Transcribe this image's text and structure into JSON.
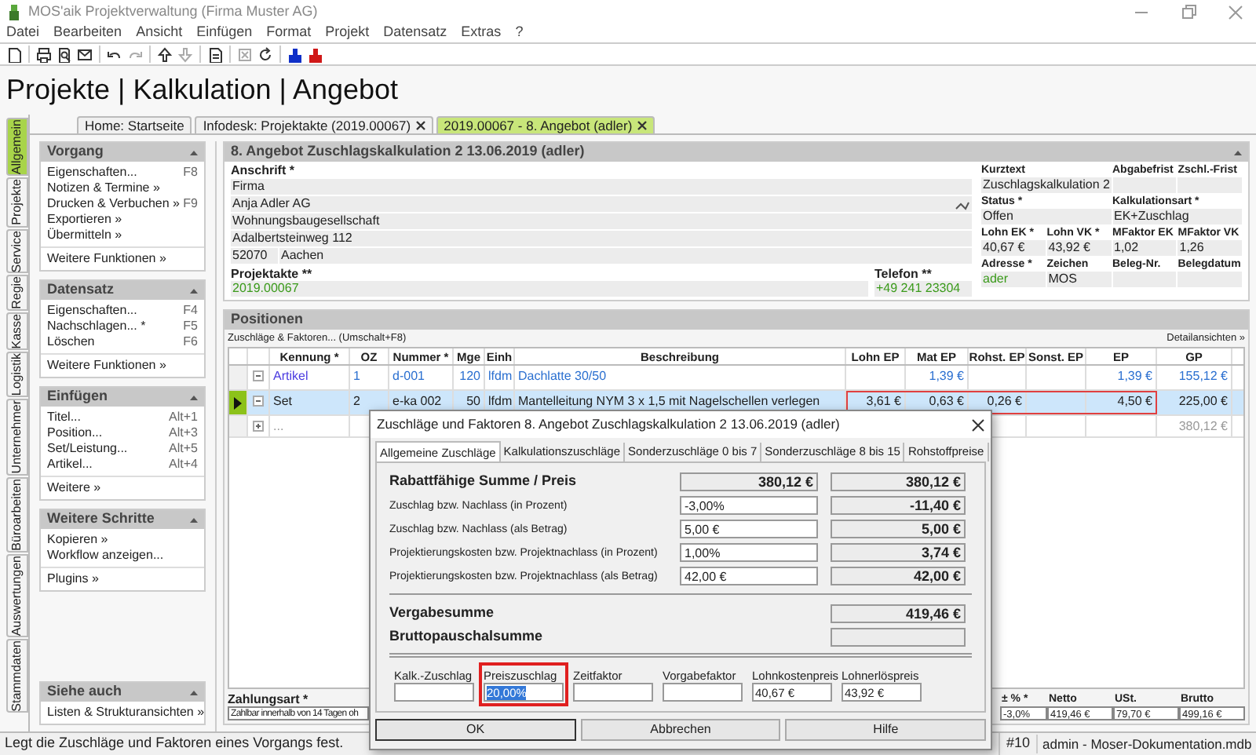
{
  "window": {
    "title": "MOS'aik Projektverwaltung (Firma Muster AG)"
  },
  "menu": [
    "Datei",
    "Bearbeiten",
    "Ansicht",
    "Einfügen",
    "Format",
    "Projekt",
    "Datensatz",
    "Extras",
    "?"
  ],
  "heading": "Projekte | Kalkulation | Angebot",
  "doc_tabs": [
    {
      "label": "Home: Startseite",
      "selected": false,
      "closable": false
    },
    {
      "label": "Infodesk: Projektakte (2019.00067)",
      "selected": false,
      "closable": true
    },
    {
      "label": "2019.00067 - 8. Angebot (adler)",
      "selected": true,
      "closable": true
    }
  ],
  "side_tabs": [
    {
      "label": "Allgemein",
      "selected": true
    },
    {
      "label": "Projekte",
      "selected": false
    },
    {
      "label": "Service",
      "selected": false
    },
    {
      "label": "Regie",
      "selected": false
    },
    {
      "label": "Kasse",
      "selected": false
    },
    {
      "label": "Logistik",
      "selected": false
    },
    {
      "label": "Unternehmer",
      "selected": false
    },
    {
      "label": "Büroarbeiten",
      "selected": false
    },
    {
      "label": "Auswertungen",
      "selected": false
    },
    {
      "label": "Stammdaten",
      "selected": false
    }
  ],
  "panels": [
    {
      "title": "Vorgang",
      "items": [
        {
          "label": "Eigenschaften...",
          "shortcut": "F8"
        },
        {
          "label": "Notizen & Termine »"
        },
        {
          "label": "Drucken & Verbuchen »",
          "shortcut": "F9"
        },
        {
          "label": "Exportieren »"
        },
        {
          "label": "Übermitteln »"
        }
      ],
      "more": [
        "Weitere Funktionen »"
      ]
    },
    {
      "title": "Datensatz",
      "items": [
        {
          "label": "Eigenschaften...",
          "shortcut": "F4"
        },
        {
          "label": "Nachschlagen... *",
          "shortcut": "F5"
        },
        {
          "label": "Löschen",
          "shortcut": "F6"
        }
      ],
      "more": [
        "Weitere Funktionen »"
      ]
    },
    {
      "title": "Einfügen",
      "items": [
        {
          "label": "Titel...",
          "shortcut": "Alt+1"
        },
        {
          "label": "Position...",
          "shortcut": "Alt+3"
        },
        {
          "label": "Set/Leistung...",
          "shortcut": "Alt+5"
        },
        {
          "label": "Artikel...",
          "shortcut": "Alt+4"
        }
      ],
      "more": [
        "Weitere »"
      ]
    },
    {
      "title": "Weitere Schritte",
      "items": [
        {
          "label": "Kopieren »"
        },
        {
          "label": "Workflow anzeigen..."
        }
      ],
      "more": [
        "Plugins »"
      ]
    },
    {
      "title": "Siehe auch",
      "items": [
        {
          "label": "Listen & Strukturansichten »"
        }
      ]
    }
  ],
  "document": {
    "title": "8. Angebot Zuschlagskalkulation 2 13.06.2019 (adler)",
    "address": {
      "label": "Anschrift *",
      "lines": [
        "Firma",
        "Anja Adler AG",
        "Wohnungsbaugesellschaft",
        "Adalbertsteinweg 112"
      ],
      "zip": "52070",
      "city": "Aachen"
    },
    "projektakte": {
      "label": "Projektakte **",
      "value": "2019.00067",
      "link": true
    },
    "telefon": {
      "label": "Telefon **",
      "value": "+49 241 23304",
      "link": true
    },
    "fields": [
      {
        "label": "Kurztext",
        "value": "Zuschlagskalkulation 2",
        "link": false
      },
      {
        "label": "Abgabefrist"
      },
      {
        "label": "Zschl.-Frist"
      },
      {
        "label": "Status *",
        "value": "Offen",
        "link": false
      },
      {
        "label": "Kalkulationsart *",
        "value": "EK+Zuschlag",
        "link": false
      },
      {
        "label": "Lohn EK *",
        "value": "40,67 €",
        "link": false
      },
      {
        "label": "Lohn VK *",
        "value": "43,92 €",
        "link": false
      },
      {
        "label": "MFaktor EK",
        "value": "1,02",
        "link": false
      },
      {
        "label": "MFaktor VK",
        "value": "1,26",
        "link": false
      },
      {
        "label": "Adresse *",
        "value": "ader",
        "link": true
      },
      {
        "label": "Zeichen",
        "value": "MOS",
        "link": false
      },
      {
        "label": "Beleg-Nr."
      },
      {
        "label": "Belegdatum"
      }
    ]
  },
  "positions": {
    "title": "Positionen",
    "action": "Zuschläge & Faktoren... (Umschalt+F8)",
    "detail_link": "Detailansichten »",
    "columns": [
      "Kennung *",
      "OZ",
      "Nummer *",
      "Mge",
      "Einh",
      "Beschreibung",
      "Lohn EP",
      "Mat EP",
      "Rohst. EP",
      "Sonst. EP",
      "EP",
      "GP"
    ],
    "rows": [
      {
        "kind": "artikel",
        "selected": false,
        "expanded": true,
        "outlined": false,
        "cells": [
          "Artikel",
          "1",
          "d-001",
          "120",
          "lfdm",
          "Dachlatte 30/50",
          null,
          "1,39 €",
          null,
          null,
          "1,39 €",
          "155,12 €"
        ]
      },
      {
        "kind": "set",
        "selected": true,
        "expanded": true,
        "outlined": true,
        "cells": [
          "Set",
          "2",
          "e-ka 002",
          "50",
          "lfdm",
          "Mantelleitung NYM 3 x 1,5 mit Nagelschellen verlegen",
          "3,61 €",
          "0,63 €",
          "0,26 €",
          null,
          "4,50 €",
          "225,00 €"
        ]
      },
      {
        "kind": "new",
        "selected": false,
        "expanded": false,
        "outlined": false,
        "cells": [
          "...",
          null,
          null,
          null,
          null,
          null,
          null,
          null,
          null,
          null,
          null,
          "380,12 €"
        ]
      }
    ]
  },
  "payment": {
    "label": "Zahlungsart *",
    "value": "Zahlbar innerhalb von 14 Tagen oh"
  },
  "totals": [
    {
      "label": "± % *",
      "value": "-3,0%"
    },
    {
      "label": "Netto",
      "value": "419,46 €"
    },
    {
      "label": "USt.",
      "value": "79,70 €"
    },
    {
      "label": "Brutto",
      "value": "499,16 €"
    }
  ],
  "dialog": {
    "title": "Zuschläge und Faktoren 8. Angebot Zuschlagskalkulation 2 13.06.2019 (adler)",
    "tabs": [
      {
        "label": "Allgemeine Zuschläge",
        "selected": true
      },
      {
        "label": "Kalkulationszuschläge",
        "selected": false
      },
      {
        "label": "Sonderzuschläge 0 bis 7",
        "selected": false
      },
      {
        "label": "Sonderzuschläge 8 bis 15",
        "selected": false
      },
      {
        "label": "Rohstoffpreise",
        "selected": false
      }
    ],
    "rows": [
      {
        "label": "Rabattfähige Summe / Preis",
        "bold": true,
        "input": "380,12 €",
        "readonly": true,
        "result": "380,12 €"
      },
      {
        "label": "Zuschlag bzw. Nachlass (in Prozent)",
        "bold": false,
        "input": "-3,00%",
        "readonly": false,
        "result": "-11,40 €"
      },
      {
        "label": "Zuschlag bzw. Nachlass (als Betrag)",
        "bold": false,
        "input": "5,00 €",
        "readonly": false,
        "result": "5,00 €"
      },
      {
        "label": "Projektierungskosten bzw. Projektnachlass (in Prozent)",
        "bold": false,
        "input": "1,00%",
        "readonly": false,
        "result": "3,74 €"
      },
      {
        "label": "Projektierungskosten bzw. Projektnachlass (als Betrag)",
        "bold": false,
        "input": "42,00 €",
        "readonly": false,
        "result": "42,00 €"
      }
    ],
    "sums": [
      {
        "label": "Vergabesumme",
        "result": "419,46 €"
      },
      {
        "label": "Bruttopauschalsumme"
      }
    ],
    "factors": [
      {
        "label": "Kalk.-Zuschlag",
        "focused": false
      },
      {
        "label": "Preiszuschlag",
        "value": "20,00%",
        "focused": true
      },
      {
        "label": "Zeitfaktor",
        "focused": false
      },
      {
        "label": "Vorgabefaktor",
        "focused": false
      },
      {
        "label": "Lohnkostenpreis",
        "value": "40,67 €",
        "focused": false
      },
      {
        "label": "Lohnerlöspreis",
        "value": "43,92 €",
        "focused": false
      }
    ],
    "buttons": [
      "OK",
      "Abbrechen",
      "Hilfe"
    ]
  },
  "status_bar": {
    "message": "Legt die Zuschläge und Faktoren eines Vorgangs fest.",
    "record": "#10",
    "database": "admin - Moser-Dokumentation.mdb"
  }
}
